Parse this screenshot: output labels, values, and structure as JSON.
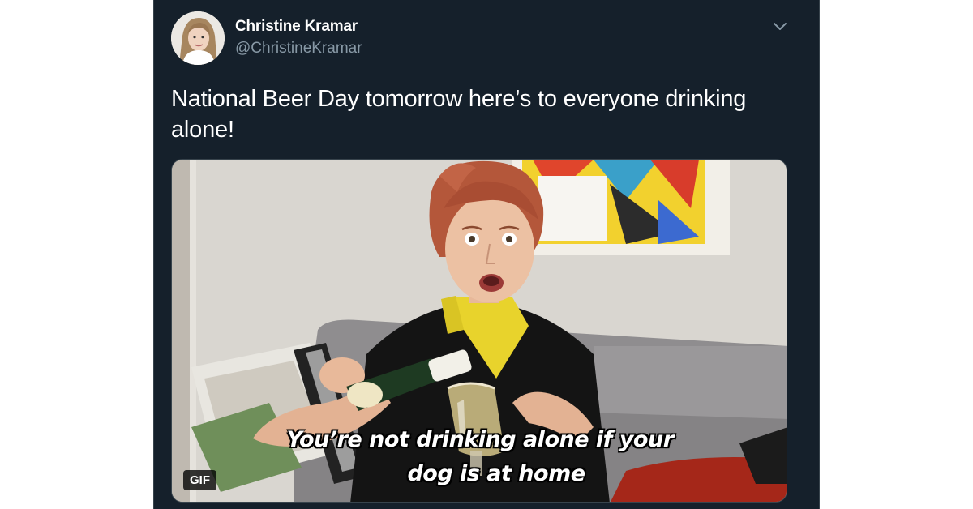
{
  "tweet": {
    "display_name": "Christine Kramar",
    "handle": "@ChristineKramar",
    "text": "National Beer Day tomorrow here’s to everyone drinking alone!",
    "menu_icon": "chevron-down-icon"
  },
  "media": {
    "type": "gif",
    "badge": "GIF",
    "subtitle_line1": "You’re not drinking alone if your",
    "subtitle_line2": "dog is at home"
  },
  "colors": {
    "background": "#15202b",
    "text_primary": "#ffffff",
    "text_secondary": "#8899a6",
    "border": "#38444d"
  }
}
